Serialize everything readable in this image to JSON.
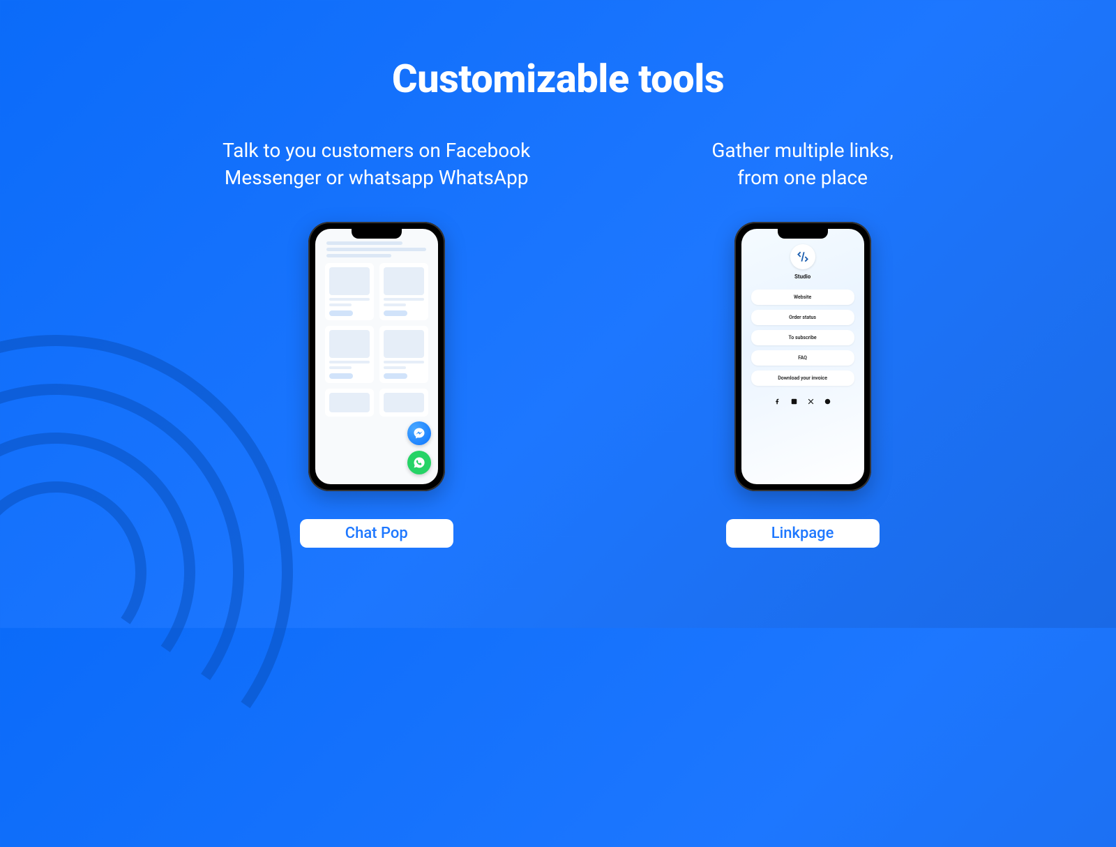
{
  "title": "Customizable tools",
  "columns": [
    {
      "description_line1": "Talk to you customers on Facebook",
      "description_line2": "Messenger or whatsapp WhatsApp",
      "cta": "Chat Pop"
    },
    {
      "description_line1": "Gather multiple links,",
      "description_line2": "from one place",
      "cta": "Linkpage"
    }
  ],
  "linkpage": {
    "brand": "Studio",
    "links": [
      "Website",
      "Order status",
      "To subscribe",
      "FAQ",
      "Download your invoice"
    ]
  }
}
